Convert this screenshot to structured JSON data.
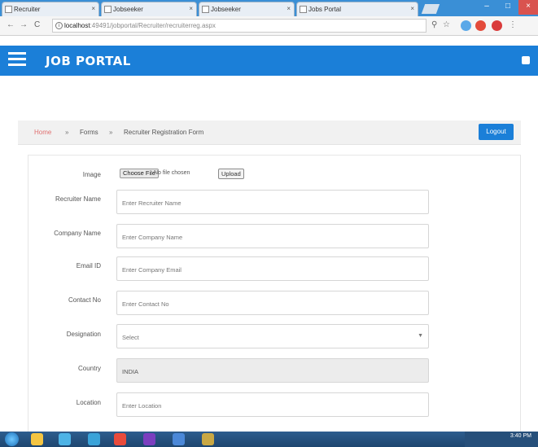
{
  "browser": {
    "tabs": [
      {
        "title": "Recruiter"
      },
      {
        "title": "Jobseeker"
      },
      {
        "title": "Jobseeker"
      },
      {
        "title": "Jobs Portal"
      }
    ],
    "url_host": "localhost",
    "url_path": ":49491/jobportal/Recruiter/recruiterreg.aspx"
  },
  "app": {
    "brand": "JOB PORTAL"
  },
  "breadcrumb": {
    "home": "Home",
    "forms": "Forms",
    "current": "Recruiter Registration Form",
    "sep1": "»",
    "sep2": "»"
  },
  "header_actions": {
    "logout": "Logout"
  },
  "form": {
    "image_label": "Image",
    "choose_file": "Choose File",
    "no_file": "No file chosen",
    "upload": "Upload",
    "fields": [
      {
        "label": "Recruiter Name",
        "placeholder": "Enter Recruiter Name"
      },
      {
        "label": "Company Name",
        "placeholder": "Enter Company Name"
      },
      {
        "label": "Email ID",
        "placeholder": "Enter Company Email"
      },
      {
        "label": "Contact No",
        "placeholder": "Enter Contact No"
      },
      {
        "label": "Designation",
        "placeholder": "Select"
      },
      {
        "label": "Country",
        "value": "INDIA"
      },
      {
        "label": "Location",
        "placeholder": "Enter Location"
      }
    ]
  },
  "taskbar": {
    "time": "3:40 PM"
  },
  "colors": {
    "primary": "#1b7fd8",
    "breadcrumb_home": "#e07070",
    "disabled_field": "#ececec"
  }
}
